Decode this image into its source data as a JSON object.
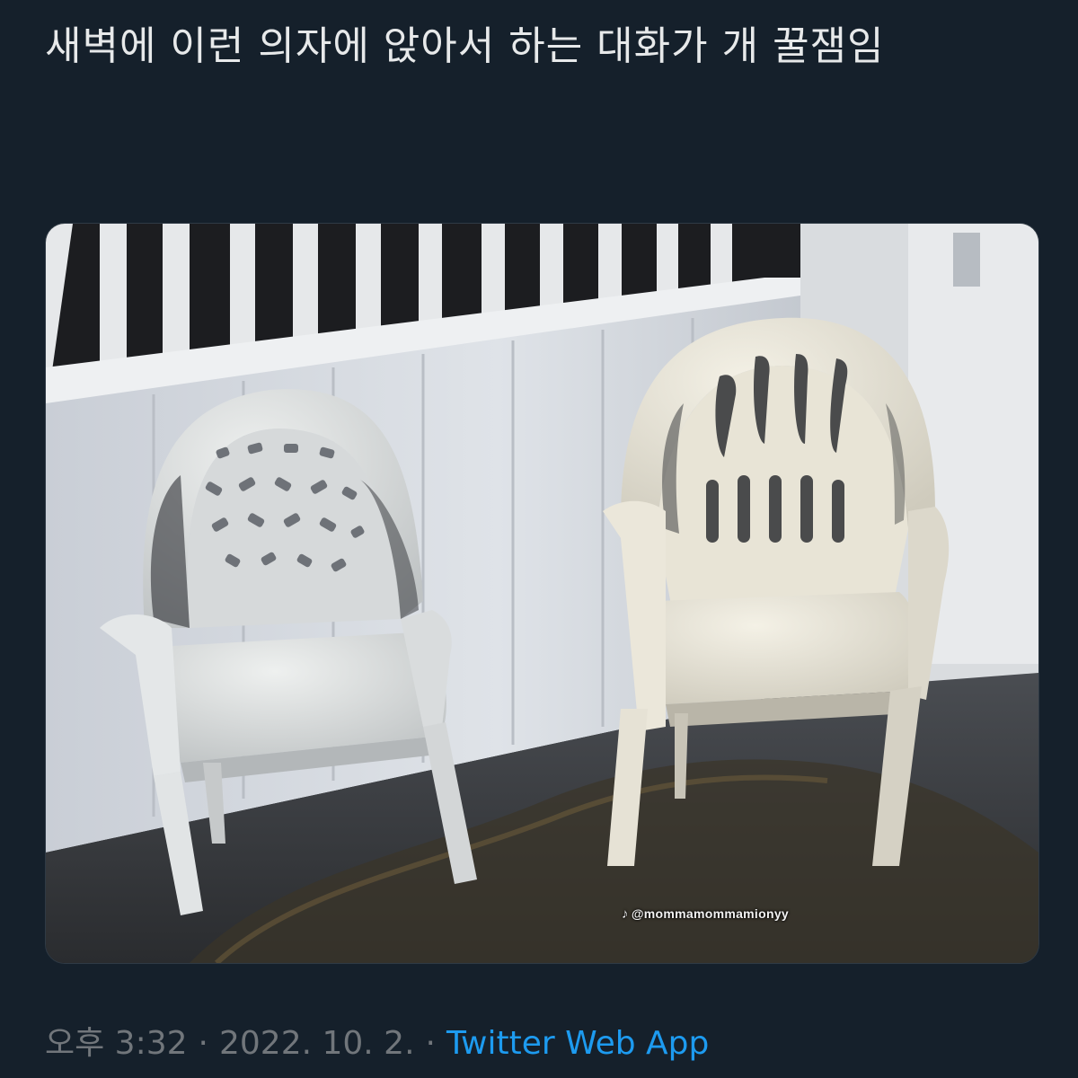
{
  "tweet": {
    "text": "새벽에 이런 의자에 앉아서 하는 대화가 개 꿀잼임",
    "media": {
      "watermark_icon": "tiktok-icon",
      "watermark_handle": "@mommamommamionyy"
    },
    "meta": {
      "time": "오후 3:32",
      "separator": "·",
      "date": "2022. 10. 2.",
      "source": "Twitter Web App"
    }
  },
  "colors": {
    "background": "#15202b",
    "text": "#e7e9ea",
    "muted": "#71767b",
    "link": "#1d9bf0"
  }
}
